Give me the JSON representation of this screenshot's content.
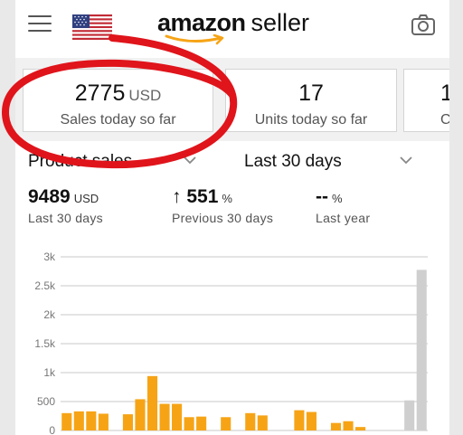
{
  "header": {
    "logo_word": "amazon",
    "logo_suffix": "seller",
    "icons": [
      "menu-icon",
      "us-flag-icon",
      "camera-icon"
    ]
  },
  "cards": [
    {
      "value": "2775",
      "unit": "USD",
      "label": "Sales today so far"
    },
    {
      "value": "17",
      "unit": "",
      "label": "Units today so far"
    },
    {
      "value": "1",
      "unit": "",
      "label": "C"
    }
  ],
  "filters": {
    "metric": "Product sales",
    "range": "Last 30 days"
  },
  "stats": [
    {
      "value": "9489",
      "unit": "USD",
      "label": "Last 30 days"
    },
    {
      "arrow": "↑",
      "value": "551",
      "unit": "%",
      "label": "Previous 30 days"
    },
    {
      "value": "--",
      "unit": "%",
      "label": "Last year"
    }
  ],
  "colors": {
    "bar": "#f6a416",
    "bar_today": "#cfcfcf",
    "highlight_circle": "#e0141b",
    "growth": "#3a9b3a"
  },
  "chart_data": {
    "type": "bar",
    "ylim": [
      0,
      3000
    ],
    "yticks": [
      "3k",
      "2.5k",
      "2k",
      "1.5k",
      "1k",
      "500",
      "0"
    ],
    "ytick_values": [
      3000,
      2500,
      2000,
      1500,
      1000,
      500,
      0
    ],
    "grid": true,
    "values": [
      300,
      330,
      330,
      290,
      0,
      280,
      540,
      940,
      460,
      460,
      230,
      240,
      0,
      230,
      0,
      300,
      260,
      0,
      0,
      350,
      320,
      0,
      130,
      160,
      60,
      0,
      0,
      0,
      520,
      2775
    ],
    "highlight_last": true
  }
}
